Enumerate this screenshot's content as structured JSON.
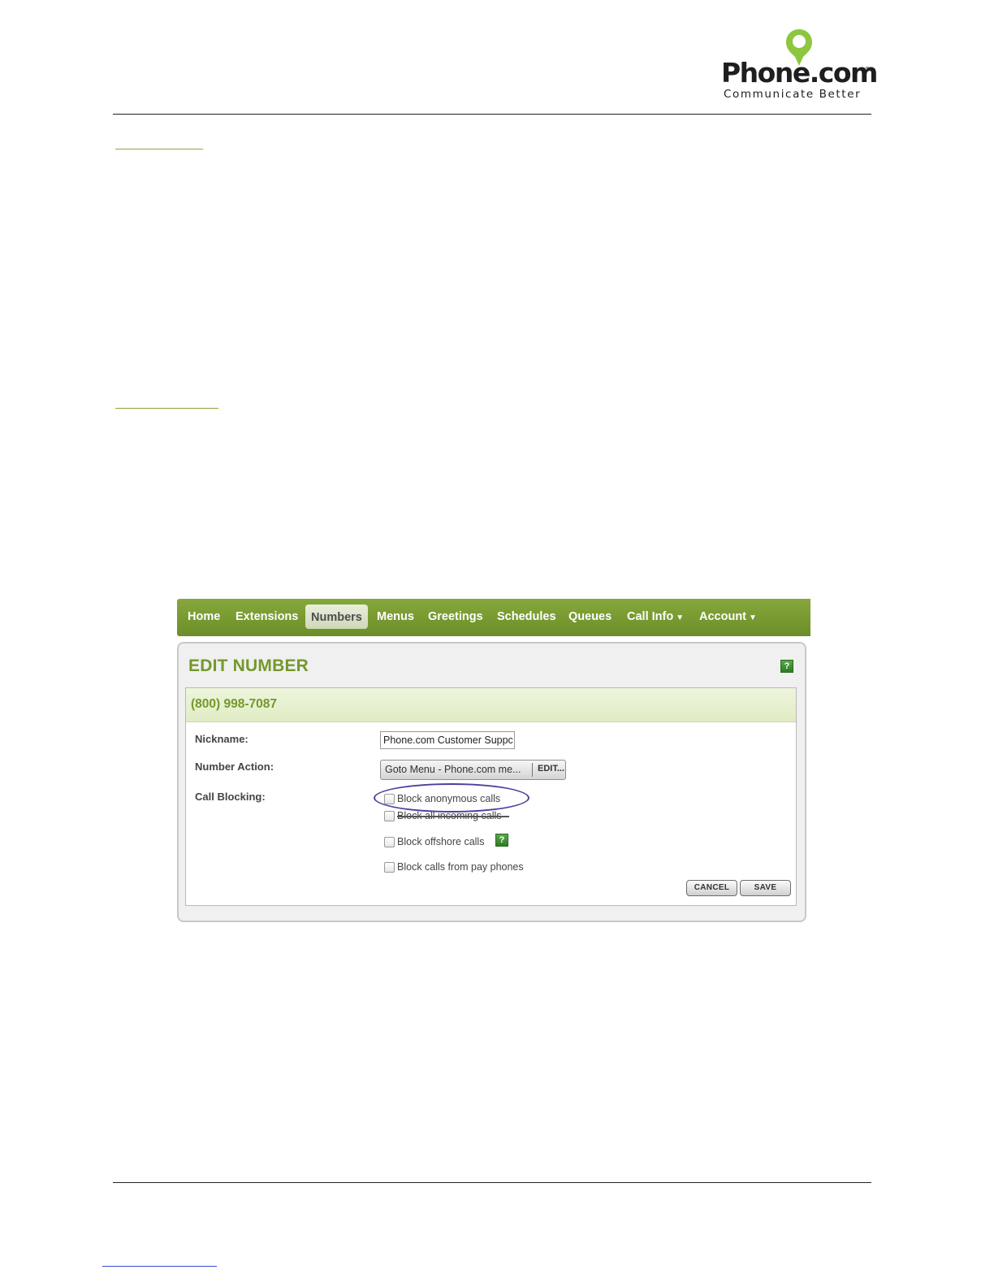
{
  "header": {
    "logo_text": "Phone.com",
    "logo_registered": "®",
    "logo_tagline": "Communicate Better"
  },
  "nav": {
    "items": [
      {
        "label": "Home"
      },
      {
        "label": "Extensions"
      },
      {
        "label": "Numbers",
        "active": true
      },
      {
        "label": "Menus"
      },
      {
        "label": "Greetings"
      },
      {
        "label": "Schedules"
      },
      {
        "label": "Queues"
      },
      {
        "label": "Call Info",
        "dropdown": true
      },
      {
        "label": "Account",
        "dropdown": true
      }
    ],
    "dropdown_caret": "▼"
  },
  "edit_number": {
    "title": "EDIT NUMBER",
    "help_icon": "?",
    "phone_number": "(800) 998-7087",
    "nickname_label": "Nickname:",
    "nickname_value": "Phone.com Customer Suppc",
    "number_action_label": "Number Action:",
    "number_action_value": "Goto Menu - Phone.com me...",
    "number_action_edit": "EDIT...",
    "call_blocking_label": "Call Blocking:",
    "call_blocking_options": [
      {
        "label": "Block anonymous calls",
        "checked": false,
        "highlighted": true
      },
      {
        "label": "Block all incoming calls",
        "checked": false,
        "struck_through": true
      },
      {
        "label": "Block offshore calls",
        "checked": false,
        "has_help": true
      },
      {
        "label": "Block calls from pay phones",
        "checked": false
      }
    ],
    "cancel_label": "CANCEL",
    "save_label": "SAVE"
  },
  "colors": {
    "brand_green": "#74982c",
    "nav_green": "#7a9c33",
    "highlight_oval": "#4f3f9e",
    "logo_pin": "#8dc63f"
  },
  "icons": {
    "logo": "location-pin-icon",
    "help": "question-help-icon",
    "caret": "caret-down-icon"
  }
}
